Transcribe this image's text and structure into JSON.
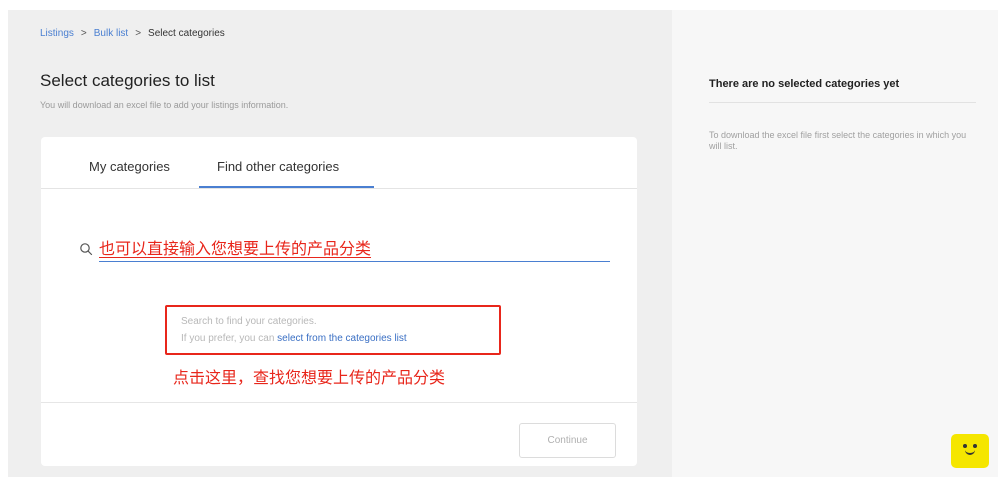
{
  "breadcrumb": {
    "items": [
      "Listings",
      "Bulk list",
      "Select categories"
    ],
    "separator": ">"
  },
  "header": {
    "title": "Select categories to list",
    "subtitle": "You will download an excel file to add your listings information."
  },
  "tabs": [
    {
      "label": "My categories",
      "active": false
    },
    {
      "label": "Find other categories",
      "active": true
    }
  ],
  "search": {
    "value": "也可以直接输入您想要上传的产品分类"
  },
  "hint": {
    "line1": "Search to find your categories.",
    "line2_prefix": "If you prefer, you can ",
    "line2_link": "select from the categories list"
  },
  "annotation": {
    "text": "点击这里，查找您想要上传的产品分类"
  },
  "footer": {
    "continue_label": "Continue"
  },
  "right_panel": {
    "title": "There are no selected categories yet",
    "description": "To download the excel file first select the categories in which you will list."
  },
  "colors": {
    "accent": "#4a7fd1",
    "annotation_red": "#e8261b",
    "helper_yellow": "#f5e600"
  },
  "icons": {
    "search": "search-icon",
    "helper": "smiley-icon"
  }
}
